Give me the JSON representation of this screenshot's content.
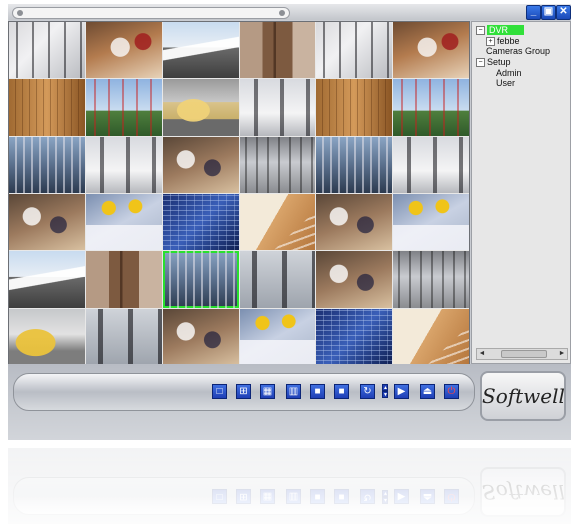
{
  "window": {
    "controls": {
      "minimize": "_",
      "restore": "▣",
      "close": "✕"
    }
  },
  "camera_grid": {
    "rows": 6,
    "cols": 6,
    "selected_index": 26,
    "tiles": [
      "crowd",
      "office",
      "train",
      "door",
      "crowd",
      "office",
      "wood",
      "flags",
      "car",
      "walk",
      "wood",
      "flags",
      "lockers",
      "walk",
      "meeting",
      "stairs",
      "lockers",
      "walk",
      "meeting",
      "workers",
      "building",
      "wallstairs",
      "meeting",
      "workers",
      "train",
      "door",
      "lockers",
      "suits",
      "meeting",
      "stairs",
      "taxi",
      "suits",
      "meeting",
      "workers",
      "building",
      "wallstairs"
    ]
  },
  "tree": {
    "root_label": "DVR",
    "items": [
      {
        "label": "febbe",
        "expander": "+"
      },
      {
        "label": "Cameras Group"
      },
      {
        "label": "Setup",
        "expander": "−"
      },
      {
        "label": "Admin"
      },
      {
        "label": "User"
      }
    ],
    "root_highlight_color": "#31e03a"
  },
  "scrollbar": {
    "left_arrow": "◄",
    "right_arrow": "►"
  },
  "toolbar": {
    "buttons": [
      {
        "name": "layout-1x1-icon",
        "glyph": "□"
      },
      {
        "name": "layout-2x2-icon",
        "glyph": "⊞"
      },
      {
        "name": "layout-3x3-icon",
        "glyph": "▦"
      },
      {
        "name": "layout-4x4-icon",
        "glyph": "▥"
      },
      {
        "name": "layout-5x5-icon",
        "glyph": "■"
      },
      {
        "name": "layout-6x6-icon",
        "glyph": "■"
      },
      {
        "name": "rotate-icon",
        "glyph": "↻"
      },
      {
        "name": "play-icon",
        "glyph": "▶"
      },
      {
        "name": "record-icon",
        "glyph": "⏏"
      },
      {
        "name": "power-icon",
        "glyph": "⏻"
      }
    ],
    "spinner": {
      "up": "▲",
      "down": "▼"
    }
  },
  "brand": {
    "logo_text": "Softwell"
  }
}
